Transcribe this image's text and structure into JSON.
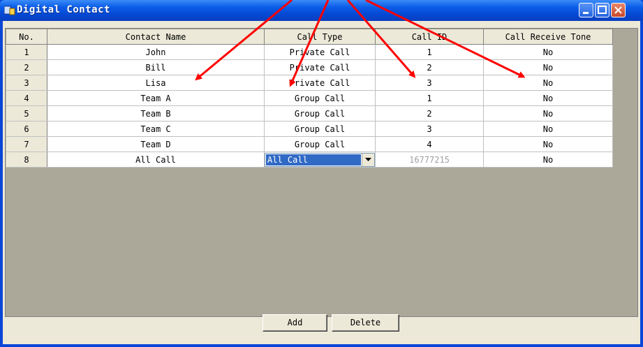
{
  "window": {
    "title": "Digital Contact"
  },
  "table": {
    "headers": [
      "No.",
      "Contact Name",
      "Call Type",
      "Call ID",
      "Call Receive Tone"
    ],
    "rows": [
      [
        "1",
        "John",
        "Private Call",
        "1",
        "No"
      ],
      [
        "2",
        "Bill",
        "Private Call",
        "2",
        "No"
      ],
      [
        "3",
        "Lisa",
        "Private Call",
        "3",
        "No"
      ],
      [
        "4",
        "Team A",
        "Group Call",
        "1",
        "No"
      ],
      [
        "5",
        "Team B",
        "Group Call",
        "2",
        "No"
      ],
      [
        "6",
        "Team C",
        "Group Call",
        "3",
        "No"
      ],
      [
        "7",
        "Team D",
        "Group Call",
        "4",
        "No"
      ],
      [
        "8",
        "All Call",
        "All Call",
        "16777215",
        "No"
      ]
    ]
  },
  "buttons": {
    "add": "Add",
    "delete": "Delete"
  },
  "colors": {
    "title_bar": "#0a5ce8",
    "annotation_arrow": "#ff0000",
    "selection": "#316ac5"
  }
}
